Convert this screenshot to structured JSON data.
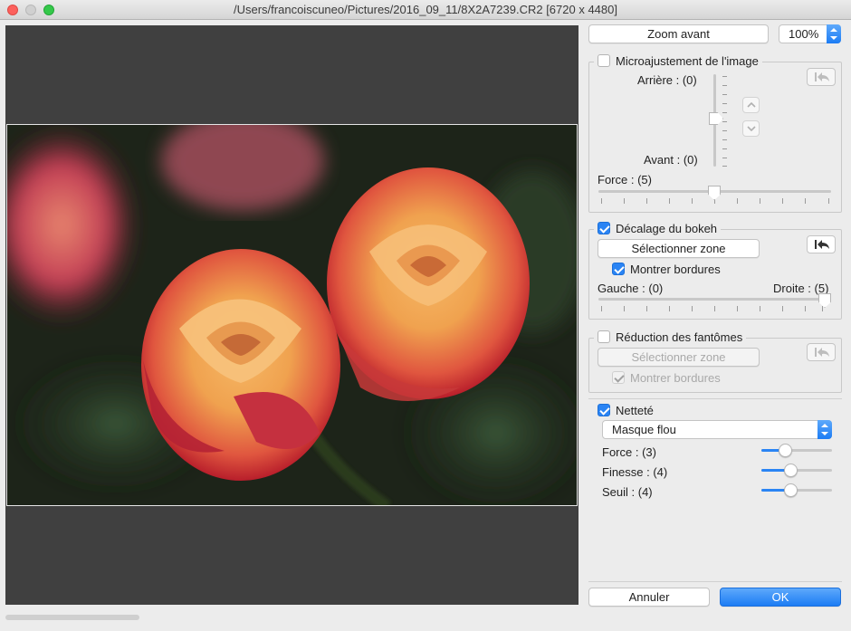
{
  "window": {
    "title": "/Users/francoiscuneo/Pictures/2016_09_11/8X2A7239.CR2 [6720 x 4480]"
  },
  "toolbar": {
    "zoom_label": "Zoom avant",
    "zoom_level": "100%"
  },
  "microajustement": {
    "title": "Microajustement de l'image",
    "checked": false,
    "arriere_label": "Arrière : (0)",
    "avant_label": "Avant : (0)",
    "force_label": "Force : (5)"
  },
  "bokeh": {
    "title": "Décalage du bokeh",
    "checked": true,
    "select_zone_label": "Sélectionner zone",
    "show_borders_label": "Montrer bordures",
    "show_borders_checked": true,
    "left_label": "Gauche : (0)",
    "right_label": "Droite : (5)"
  },
  "fantomes": {
    "title": "Réduction des fantômes",
    "checked": false,
    "select_zone_label": "Sélectionner zone",
    "show_borders_label": "Montrer bordures",
    "show_borders_checked": true
  },
  "nettete": {
    "title": "Netteté",
    "checked": true,
    "mode_selected": "Masque flou",
    "force_label": "Force : (3)",
    "finesse_label": "Finesse : (4)",
    "seuil_label": "Seuil : (4)"
  },
  "footer": {
    "cancel_label": "Annuler",
    "ok_label": "OK"
  },
  "colors": {
    "accent": "#2a84f4",
    "preview_bg": "#404040"
  }
}
